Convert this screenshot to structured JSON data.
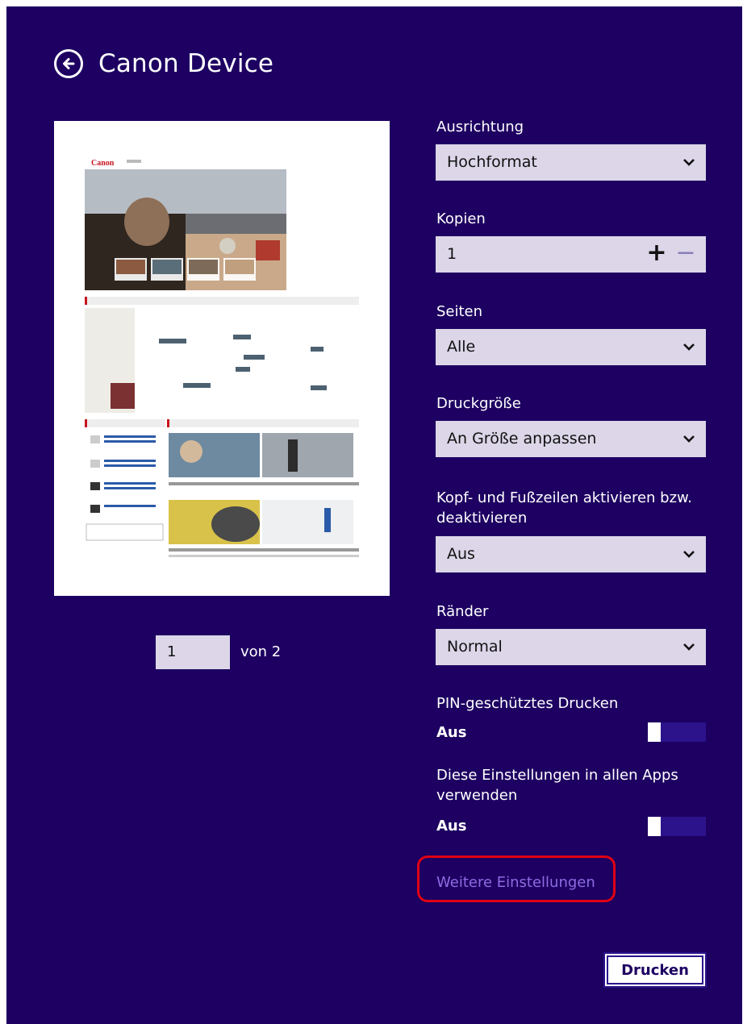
{
  "app": {
    "title": "Canon Device"
  },
  "preview": {
    "logo_text": "Canon",
    "page_current": "1",
    "page_of_label": "von 2"
  },
  "settings": {
    "orientation": {
      "label": "Ausrichtung",
      "value": "Hochformat"
    },
    "copies": {
      "label": "Kopien",
      "value": "1",
      "plus": "+",
      "minus": "−"
    },
    "pages": {
      "label": "Seiten",
      "value": "Alle"
    },
    "print_size": {
      "label": "Druckgröße",
      "value": "An Größe anpassen"
    },
    "header_footer": {
      "label": "Kopf- und Fußzeilen aktivieren bzw. deaktivieren",
      "value": "Aus"
    },
    "margins": {
      "label": "Ränder",
      "value": "Normal"
    },
    "pin_print": {
      "label": "PIN-geschütztes Drucken",
      "state": "Aus"
    },
    "all_apps": {
      "label": "Diese Einstellungen in allen Apps verwenden",
      "state": "Aus"
    }
  },
  "more_settings_link": "Weitere Einstellungen",
  "print_button": "Drucken",
  "colors": {
    "background": "#1d0061",
    "field": "#dcd6e8",
    "link": "#8e6be3",
    "highlight": "#e00014"
  }
}
